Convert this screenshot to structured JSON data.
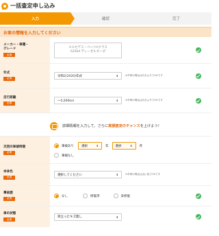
{
  "header": {
    "title": "一括査定申し込み"
  },
  "steps": [
    {
      "label": "入力"
    },
    {
      "label": "確認"
    },
    {
      "label": "完了"
    }
  ],
  "section": {
    "title": "お車の情報を入力してください"
  },
  "required_badge": "必須",
  "fields": {
    "maker": {
      "label_line1": "メーカー・車種・",
      "label_line2": "グレード",
      "value_line1": "メルセデス・ベンツAクラス",
      "value_line2": "A200d ディーゼルターボ"
    },
    "year": {
      "label": "年式",
      "value": "令和2(2020)年式",
      "note": "※不明の場合はおおよそでOKです"
    },
    "mileage": {
      "label": "走行距離",
      "value": "〜5,000km",
      "note": "※不明の場合はおおよそでOKです"
    }
  },
  "promo": {
    "prefix": "詳細情報を入力して、さらに",
    "emphasis": "高額査定のチャンス",
    "suffix": "を上げよう！"
  },
  "details": {
    "inspection": {
      "label": "次回の車検時期",
      "option_yes": "車検あり",
      "year_select": "選択",
      "year_unit": "年",
      "month_select": "選択",
      "month_unit": "月",
      "option_no": "車検なし"
    },
    "color": {
      "label": "本体色",
      "value": "選択してください",
      "note": "※不明の場合は近い色でOKです"
    },
    "accident": {
      "label": "事故歴",
      "options": [
        "なし",
        "修復済",
        "未修復"
      ]
    },
    "condition": {
      "label": "車の状態",
      "value": "目立ったキズ無し"
    }
  },
  "colors": {
    "accent": "#f39800",
    "accent_dark": "#e8680a",
    "ok": "#44b85a",
    "label_bg": "#fdf0e1"
  }
}
